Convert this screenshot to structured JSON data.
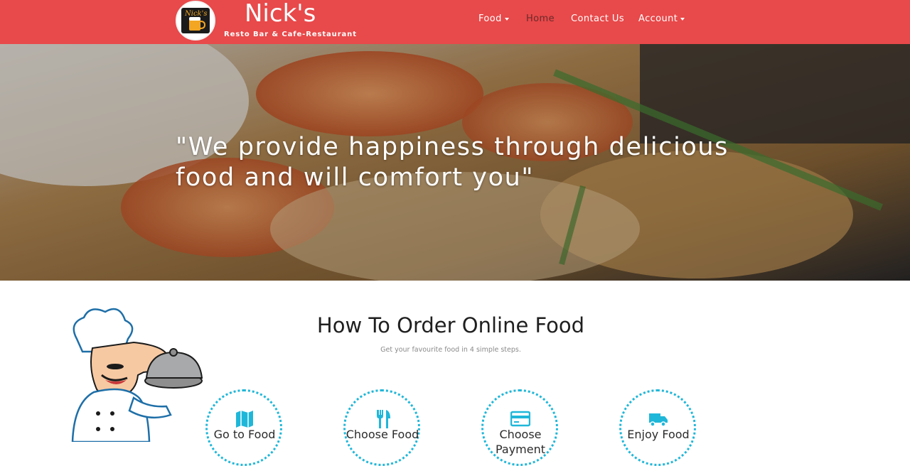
{
  "brand": {
    "name": "Nick's",
    "tagline": "Resto Bar & Cafe-Restaurant",
    "logo_text": "Nick's"
  },
  "nav": {
    "food": "Food",
    "home": "Home",
    "contact": "Contact Us",
    "account": "Account"
  },
  "hero": {
    "quote": "\"We provide happiness through delicious food and will comfort you\""
  },
  "how_to_order": {
    "title": "How To Order Online Food",
    "subtitle": "Get your favourite food in 4 simple steps.",
    "steps": [
      {
        "label": "Go to Food",
        "icon": "map-icon"
      },
      {
        "label": "Choose Food",
        "icon": "utensils-icon"
      },
      {
        "label": "Choose Payment",
        "icon": "credit-card-icon"
      },
      {
        "label": "Enjoy Food",
        "icon": "truck-icon"
      }
    ]
  },
  "colors": {
    "navbar": "#e8494a",
    "accent": "#1fb7d9",
    "active_nav": "#6a2a2a"
  }
}
